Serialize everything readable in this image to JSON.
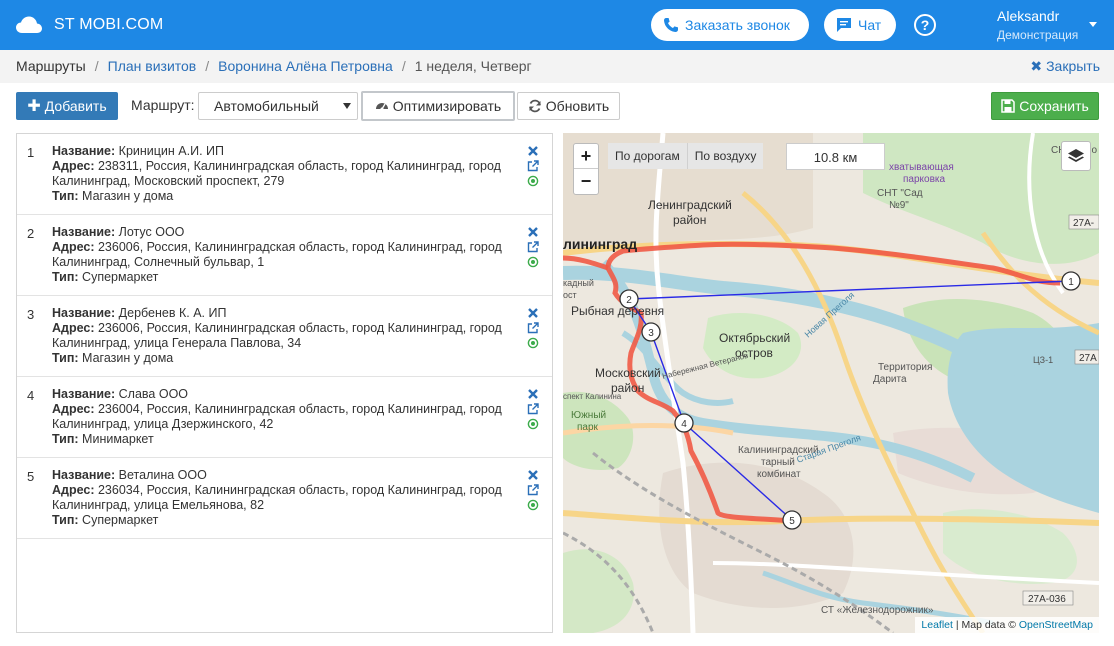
{
  "header": {
    "brand": "ST MOBI.COM",
    "call_button": "Заказать звонок",
    "chat_button": "Чат",
    "help": "?",
    "user_name": "Aleksandr",
    "user_role": "Демонстрация"
  },
  "breadcrumbs": {
    "items": [
      "Маршруты",
      "План визитов",
      "Воронина Алёна Петровна"
    ],
    "current": "1 неделя, Четверг",
    "close": "Закрыть"
  },
  "toolbar": {
    "add": "Добавить",
    "route_label": "Маршрут:",
    "route_value": "Автомобильный",
    "optimize": "Оптимизировать",
    "refresh": "Обновить",
    "save": "Сохранить"
  },
  "field_labels": {
    "name": "Название:",
    "address": "Адрес:",
    "type": "Тип:"
  },
  "visits": [
    {
      "num": "1",
      "name": "Криницин А.И. ИП",
      "address": "238311, Россия, Калининградская область, город Калининград, город Калининград, Московский проспект, 279",
      "type": "Магазин у дома"
    },
    {
      "num": "2",
      "name": "Лотус ООО",
      "address": "236006, Россия, Калининградская область, город Калининград, город Калининград, Солнечный бульвар, 1",
      "type": "Супермаркет"
    },
    {
      "num": "3",
      "name": "Дербенев К. А. ИП",
      "address": "236006, Россия, Калининградская область, город Калининград, город Калининград, улица Генерала Павлова, 34",
      "type": "Магазин у дома"
    },
    {
      "num": "4",
      "name": "Слава ООО",
      "address": "236004, Россия, Калининградская область, город Калининград, город Калининград, улица Дзержинского, 42",
      "type": "Минимаркет"
    },
    {
      "num": "5",
      "name": "Веталина ООО",
      "address": "236034, Россия, Калининградская область, город Калининград, город Калининград, улица Емельянова, 82",
      "type": "Супермаркет"
    }
  ],
  "map": {
    "zoom_in": "+",
    "zoom_out": "−",
    "mode_road": "По дорогам",
    "mode_air": "По воздуху",
    "distance": "10.8 км",
    "labels": {
      "leningradsky": "Ленинградский",
      "rayon": "район",
      "kaliningrad": "лининград",
      "rybnaya": "Рыбная деревня",
      "oktyabrsky": "Октябрьский",
      "ostrov": "остров",
      "moskovsky": "Московский",
      "yuzhny": "Южный",
      "park": "парк",
      "territory": "Территория",
      "darita": "Дарита",
      "kombinat1": "Калининградский",
      "kombinat2": "тарный",
      "kombinat3": "комбинат",
      "parkovka1": "хватывающая",
      "parkovka2": "парковка",
      "snt_sad": "СНТ \"Сад",
      "snt_9": "№9\"",
      "snt_kolos": "СНТ Коло",
      "zhd": "СТ «Железнодорожник»",
      "road_27a_1": "27А-",
      "road_27a_2": "27А",
      "road_27a_036": "27А-036",
      "ts3": "ЦЗ-1",
      "naberezhnaya": "Набережная Ветеранов",
      "novaya": "Новая Преголя",
      "staraya": "Старая Преголя",
      "prospekt": "спект Калинина",
      "kadny": "кадный",
      "ost": "ост"
    },
    "markers": [
      "1",
      "2",
      "3",
      "4",
      "5"
    ],
    "attribution_leaflet": "Leaflet",
    "attribution_text": " | Map data © ",
    "attribution_osm": "OpenStreetMap"
  },
  "colors": {
    "primary": "#1e88e5",
    "add_button": "#337ab7",
    "save_button": "#4cae4c",
    "route_road": "#f05a46",
    "route_air": "#2a2ae6"
  }
}
